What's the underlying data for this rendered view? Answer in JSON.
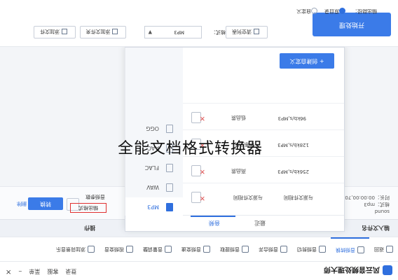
{
  "app": {
    "title": "风云音频处理大师",
    "menu": "菜单",
    "support": "客服",
    "login": "登录"
  },
  "toolbar": {
    "tabs": [
      "返回",
      "音频转换",
      "音频剪切",
      "音频合并",
      "音频提取",
      "音频变速",
      "音量调整",
      "视频变音",
      "添加背景音乐"
    ]
  },
  "table_header": {
    "input_file": "输入文件名",
    "operation": "操作"
  },
  "file": {
    "name": "sound",
    "format": "格式：mp3",
    "duration": "时长：00:00:00,70",
    "convert_button": "转换",
    "output_format_link": "输出格式",
    "audio_settings_link": "音频参数",
    "delete_link": "删除"
  },
  "popup": {
    "tabs": [
      "最近",
      "音频"
    ],
    "active_tab": "音频",
    "formats": [
      "MP3",
      "WAV",
      "FLAC",
      "AAC",
      "OGG"
    ],
    "selected_format": "MP3",
    "presets": [
      {
        "name": "与源文件相同",
        "quality": "与源文件相同"
      },
      {
        "name": "高品质",
        "quality": "256kb/s,MP3"
      },
      {
        "name": "中等品质",
        "quality": "128kb/s,MP3"
      },
      {
        "name": "低品质",
        "quality": "96kb/s,MP3"
      }
    ],
    "custom_button": "+ 创建自定义"
  },
  "bottom": {
    "add_file": "添加文件",
    "add_folder": "添加文件夹",
    "clear_list": "清空列表",
    "output_format_label": "输出格式：",
    "output_format_value": "MP3",
    "start_button": "开始处理",
    "output_dir_label": "输出路径：",
    "option_original": "原目录",
    "option_custom": "自定义"
  },
  "caption": "全能文档格式转换器",
  "colors": {
    "accent": "#3b7be8",
    "highlight": "#e03030"
  }
}
